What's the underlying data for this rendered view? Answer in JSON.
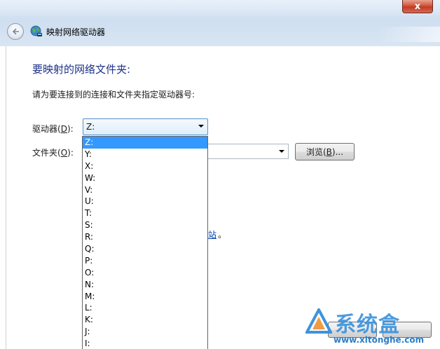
{
  "window": {
    "close_glyph": "x",
    "title": "映射网络驱动器"
  },
  "main": {
    "heading": "要映射的网络文件夹:",
    "description": "请为要连接到的连接和文件夹指定驱动器号:",
    "drive_label_prefix": "驱动器(",
    "drive_label_key": "D",
    "drive_label_suffix": "):",
    "folder_label_prefix": "文件夹(",
    "folder_label_key": "O",
    "folder_label_suffix": "):",
    "drive_value": "Z:",
    "folder_value": "",
    "browse_prefix": "浏览(",
    "browse_key": "B",
    "browse_suffix": ")...",
    "link_fragment": "站",
    "link_period": "。"
  },
  "drive_options": [
    "Z:",
    "Y:",
    "X:",
    "W:",
    "V:",
    "U:",
    "T:",
    "S:",
    "R:",
    "Q:",
    "P:",
    "O:",
    "N:",
    "M:",
    "L:",
    "K:",
    "J:",
    "I:"
  ],
  "selected_option": "Z:",
  "watermark": {
    "text": "系统盒",
    "url": "www.xitonghe.com"
  },
  "colors": {
    "heading": "#1e3287",
    "selection": "#3399ff",
    "close_button": "#c23a22",
    "watermark": "#3d93dd"
  },
  "icons": {
    "back": "back-arrow-icon",
    "wizard": "network-globe-icon",
    "close": "close-icon",
    "dropdown": "chevron-down-icon"
  }
}
